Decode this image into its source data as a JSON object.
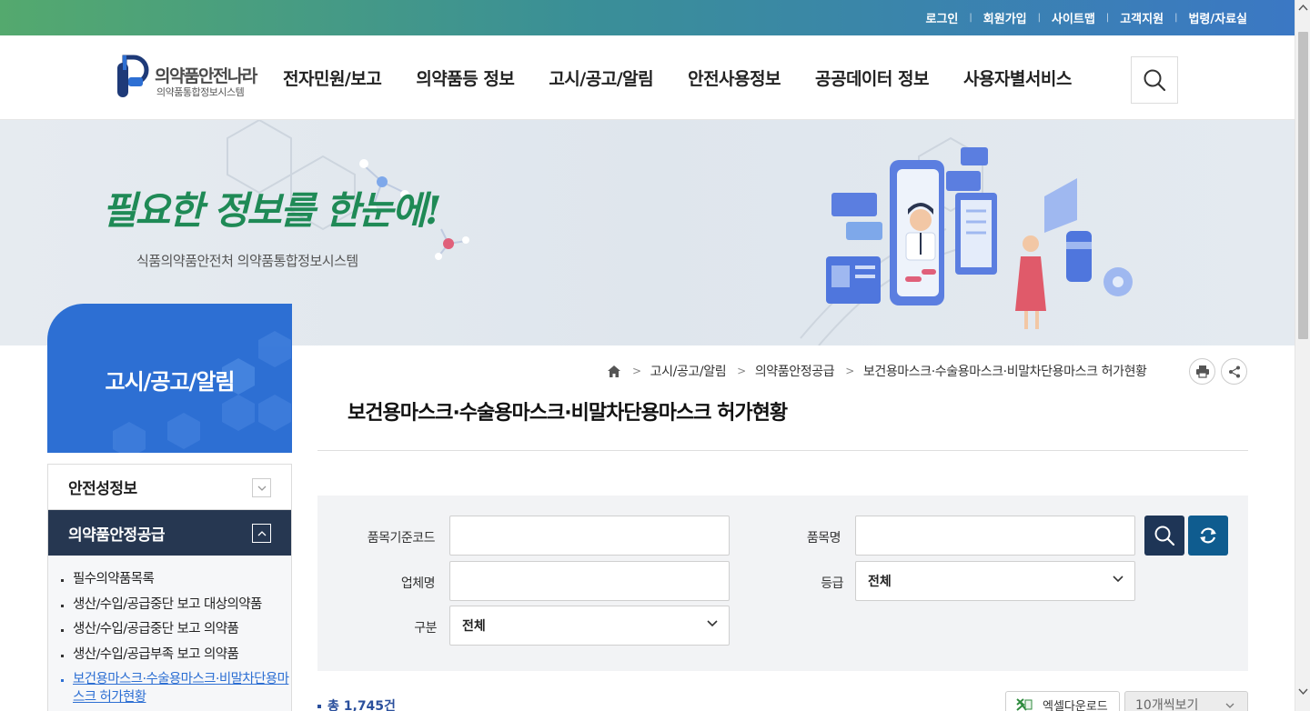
{
  "util_nav": [
    "로그인",
    "회원가입",
    "사이트맵",
    "고객지원",
    "법령/자료실"
  ],
  "logo": {
    "title": "의약품안전나라",
    "subtitle": "의약품통합정보시스템"
  },
  "gnb": [
    "전자민원/보고",
    "의약품등 정보",
    "고시/공고/알림",
    "안전사용정보",
    "공공데이터 정보",
    "사용자별서비스"
  ],
  "hero": {
    "slogan": "필요한 정보를 한눈에!",
    "subtitle": "식품의약품안전처 의약품통합정보시스템"
  },
  "sidebar": {
    "title": "고시/공고/알림",
    "sections": [
      {
        "label": "안전성정보"
      },
      {
        "label": "의약품안정공급"
      }
    ],
    "sub_items": [
      "필수의약품목록",
      "생산/수입/공급중단 보고 대상의약품",
      "생산/수입/공급중단 보고 의약품",
      "생산/수입/공급부족 보고 의약품",
      "보건용마스크·수술용마스크·비말차단용마스크 허가현황"
    ]
  },
  "breadcrumb": [
    "고시/공고/알림",
    "의약품안정공급",
    "보건용마스크·수술용마스크·비말차단용마스크 허가현황"
  ],
  "page_title": "보건용마스크·수술용마스크·비말차단용마스크 허가현황",
  "form": {
    "item_code_label": "품목기준코드",
    "item_name_label": "품목명",
    "company_label": "업체명",
    "grade_label": "등급",
    "grade_value": "전체",
    "category_label": "구분",
    "category_value": "전체"
  },
  "results": {
    "total": "총 1,745건",
    "excel_label": "엑셀다운로드",
    "per_page": "10개씩보기"
  },
  "colors": {
    "primary": "#2d6fd3",
    "navy": "#263751",
    "search_btn": "#1e3556",
    "reset_btn": "#0f5c8f"
  }
}
